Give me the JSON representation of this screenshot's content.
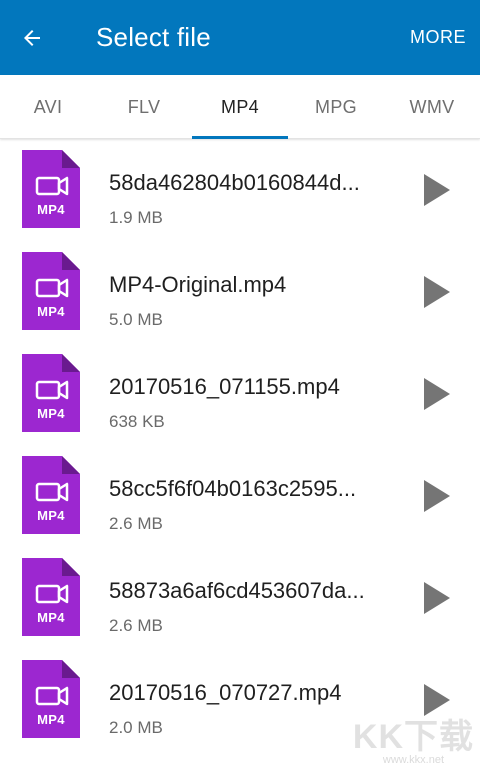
{
  "appbar": {
    "title": "Select file",
    "more_label": "MORE",
    "back_icon": "arrow-left-icon",
    "color": "#0277bd"
  },
  "tabs": [
    {
      "label": "AVI",
      "active": false
    },
    {
      "label": "FLV",
      "active": false
    },
    {
      "label": "MP4",
      "active": true
    },
    {
      "label": "MPG",
      "active": false
    },
    {
      "label": "WMV",
      "active": false
    }
  ],
  "file_icon": {
    "badge": "MP4",
    "color": "#9c27d0",
    "icon": "video-camera-icon"
  },
  "files": [
    {
      "name": "58da462804b0160844d...",
      "size": "1.9 MB"
    },
    {
      "name": "MP4-Original.mp4",
      "size": "5.0 MB"
    },
    {
      "name": "20170516_071155.mp4",
      "size": "638 KB"
    },
    {
      "name": "58cc5f6f04b0163c2595...",
      "size": "2.6 MB"
    },
    {
      "name": "58873a6af6cd453607da...",
      "size": "2.6 MB"
    },
    {
      "name": "20170516_070727.mp4",
      "size": "2.0 MB"
    }
  ],
  "watermark": {
    "main": "KK下载",
    "sub": "www.kkx.net"
  }
}
